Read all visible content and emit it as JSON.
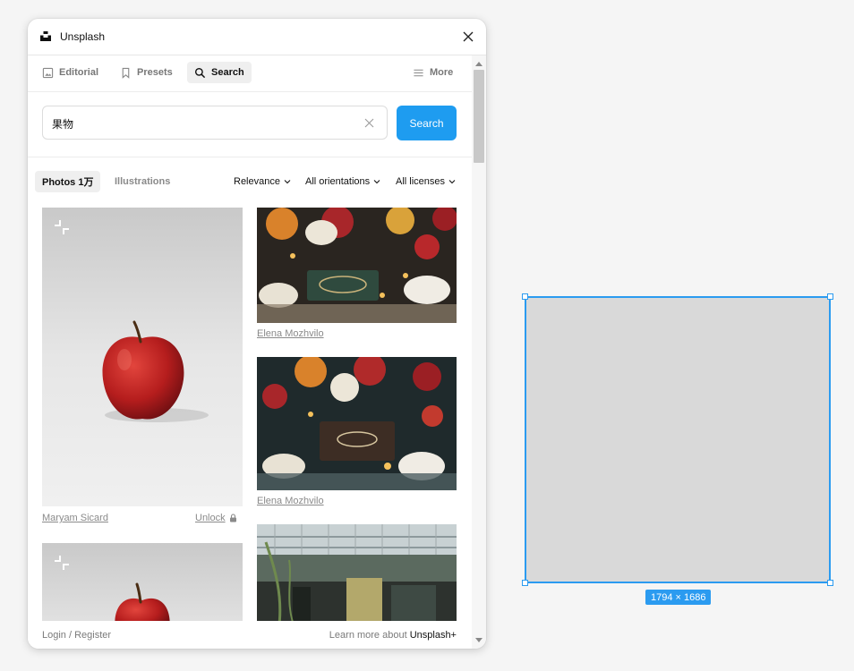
{
  "window": {
    "title": "Unsplash"
  },
  "tabs": [
    {
      "label": "Editorial",
      "icon": "image-icon",
      "active": false
    },
    {
      "label": "Presets",
      "icon": "bookmark-icon",
      "active": false
    },
    {
      "label": "Search",
      "icon": "search-icon",
      "active": true
    },
    {
      "label": "More",
      "icon": "menu-icon",
      "active": false
    }
  ],
  "search": {
    "value": "果物",
    "button_label": "Search"
  },
  "filters": {
    "photos_label": "Photos 1万",
    "illustrations_label": "Illustrations",
    "relevance": "Relevance",
    "orientation": "All orientations",
    "license": "All licenses"
  },
  "results": {
    "left": [
      {
        "author": "Maryam Sicard",
        "unlock_label": "Unlock",
        "premium": true
      },
      {
        "author": "",
        "premium": true
      }
    ],
    "right": [
      {
        "author": "Elena Mozhvilo"
      },
      {
        "author": "Elena Mozhvilo"
      },
      {
        "author": ""
      }
    ]
  },
  "footer": {
    "login_label": "Login / Register",
    "learn_text": "Learn more about",
    "learn_link": "Unsplash+"
  },
  "canvas": {
    "frame_size_label": "1794 × 1686"
  },
  "colors": {
    "accent": "#1e9cf0",
    "selection": "#2b9bf0",
    "frame_fill": "#d9d9d9"
  }
}
